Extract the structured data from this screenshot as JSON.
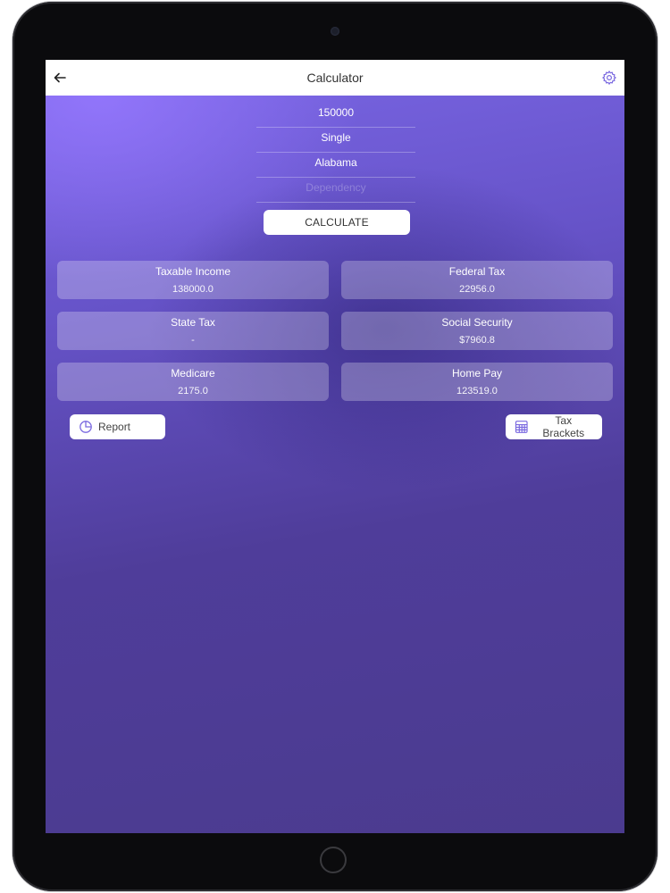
{
  "header": {
    "title": "Calculator",
    "back_icon": "arrow-left-icon",
    "settings_icon": "gear-icon"
  },
  "inputs": {
    "income": "150000",
    "filing_status": "Single",
    "state": "Alabama",
    "dependency_placeholder": "Dependency"
  },
  "calculate_label": "CALCULATE",
  "results": [
    {
      "label": "Taxable Income",
      "value": "138000.0"
    },
    {
      "label": "Federal Tax",
      "value": "22956.0"
    },
    {
      "label": "State Tax",
      "value": "-"
    },
    {
      "label": "Social Security",
      "value": "$7960.8"
    },
    {
      "label": "Medicare",
      "value": "2175.0"
    },
    {
      "label": "Home Pay",
      "value": "123519.0"
    }
  ],
  "actions": {
    "report_label": "Report",
    "report_icon": "pie-chart-icon",
    "brackets_label": "Tax Brackets",
    "brackets_icon": "calculator-icon"
  },
  "colors": {
    "accent": "#6a57d0",
    "icon_accent": "#7b6ae0"
  }
}
